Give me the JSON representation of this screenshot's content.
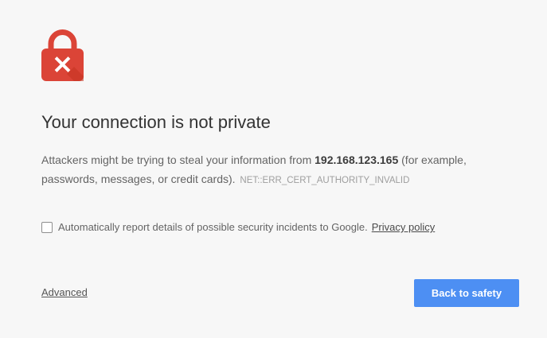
{
  "icon": {
    "name": "lock-error-icon",
    "color": "#db4437",
    "mark_color": "#ffffff"
  },
  "interstitial": {
    "heading": "Your connection is not private",
    "message_prefix": "Attackers might be trying to steal your information from ",
    "host": "192.168.123.165",
    "message_suffix": " (for example, passwords, messages, or credit cards).",
    "error_code": "NET::ERR_CERT_AUTHORITY_INVALID"
  },
  "report": {
    "checkbox_checked": false,
    "label": "Automatically report details of possible security incidents to Google.",
    "privacy_link": "Privacy policy"
  },
  "actions": {
    "advanced_label": "Advanced",
    "back_label": "Back to safety",
    "primary_color": "#4d8ff3"
  }
}
